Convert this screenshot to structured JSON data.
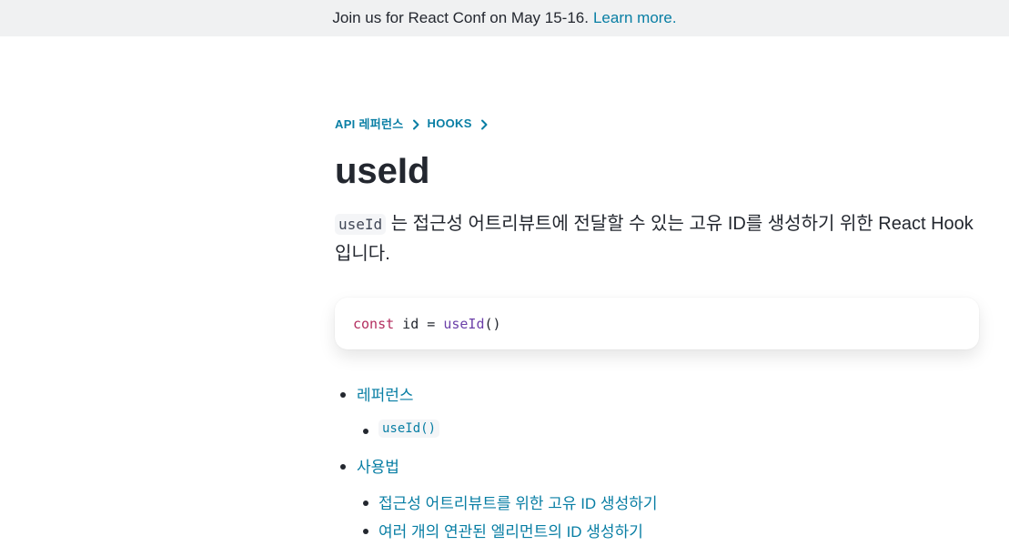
{
  "banner": {
    "text": "Join us for React Conf on May 15-16.",
    "link_label": "Learn more."
  },
  "breadcrumb": [
    "API 레퍼런스",
    "HOOKS"
  ],
  "title": "useId",
  "intro": {
    "code": "useId",
    "text": " 는 접근성 어트리뷰트에 전달할 수 있는 고유 ID를 생성하기 위한 React Hook입니다."
  },
  "code_sample": {
    "keyword": "const",
    "middle": " id = ",
    "fn": "useId",
    "tail": "()"
  },
  "toc": {
    "reference": "레퍼런스",
    "reference_sub": "useId()",
    "usage": "사용법",
    "usage_sub": [
      "접근성 어트리뷰트를 위한 고유 ID 생성하기",
      "여러 개의 연관된 엘리먼트의 ID 생성하기"
    ]
  },
  "colors": {
    "link": "#087ea4",
    "text": "#23272f",
    "banner_bg": "#f0f1f2",
    "keyword": "#b32e5f",
    "function": "#6b3fa8"
  }
}
